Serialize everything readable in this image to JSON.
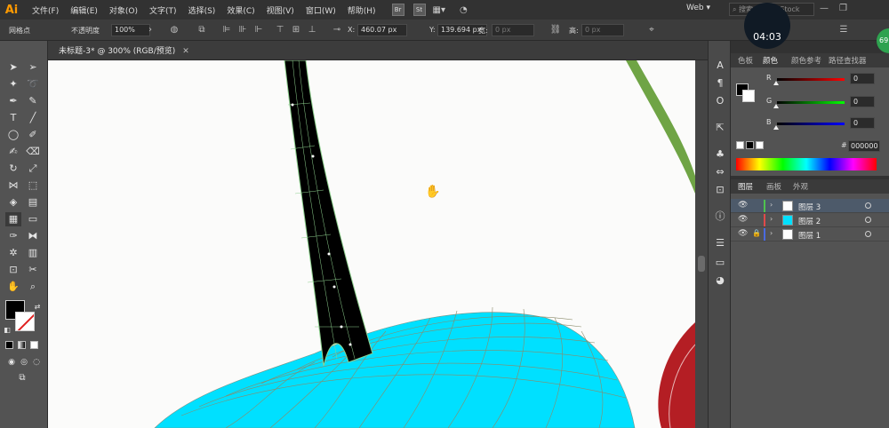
{
  "app": {
    "logo": "Ai",
    "menu": [
      "文件(F)",
      "编辑(E)",
      "对象(O)",
      "文字(T)",
      "选择(S)",
      "效果(C)",
      "视图(V)",
      "窗口(W)",
      "帮助(H)"
    ],
    "bridge_label": "Br",
    "stock_label": "St",
    "workspace": "Web",
    "search_placeholder": "搜索 Adobe Stock"
  },
  "control_bar": {
    "tool_name": "网格点",
    "opacity_label": "不透明度",
    "opacity_value": "100%",
    "x_label": "X:",
    "x_value": "460.07 px",
    "y_label": "Y:",
    "y_value": "139.694 px",
    "w_label": "宽:",
    "w_value": "0 px",
    "h_label": "高:",
    "h_value": "0 px"
  },
  "document": {
    "tab_title": "未标题-3* @ 300% (RGB/预览)"
  },
  "color_panel": {
    "tabs": [
      "色板",
      "颜色",
      "颜色参考",
      "路径查找器"
    ],
    "active_tab": "颜色",
    "sliders": [
      {
        "channel": "R",
        "value": "0",
        "gradient": [
          "#000000",
          "#ff0000"
        ]
      },
      {
        "channel": "G",
        "value": "0",
        "gradient": [
          "#000000",
          "#00ff00"
        ]
      },
      {
        "channel": "B",
        "value": "0",
        "gradient": [
          "#000000",
          "#0000ff"
        ]
      }
    ],
    "hex_label": "#",
    "hex_value": "000000"
  },
  "layers_panel": {
    "tabs": [
      "图层",
      "画板",
      "外观"
    ],
    "active_tab": "图层",
    "layers": [
      {
        "name": "图层 3",
        "color": "#4fc24f",
        "selected": true,
        "locked": false,
        "thumb": "#ffffff"
      },
      {
        "name": "图层 2",
        "color": "#e04a4a",
        "selected": false,
        "locked": false,
        "thumb": "#00e0ff"
      },
      {
        "name": "图层 1",
        "color": "#4a6ae0",
        "selected": false,
        "locked": true,
        "thumb": "#ffffff"
      }
    ]
  },
  "overlay": {
    "timer": "04:03",
    "badge": "69"
  },
  "colors": {
    "cherry_fill": "#00e0ff",
    "stem_fill": "#000000",
    "mesh_lines": "#8b8b6a",
    "cherry_red": "#b41e24",
    "stem_green": "#6fa445"
  },
  "icons": {
    "hand_cursor": "hand-icon"
  }
}
